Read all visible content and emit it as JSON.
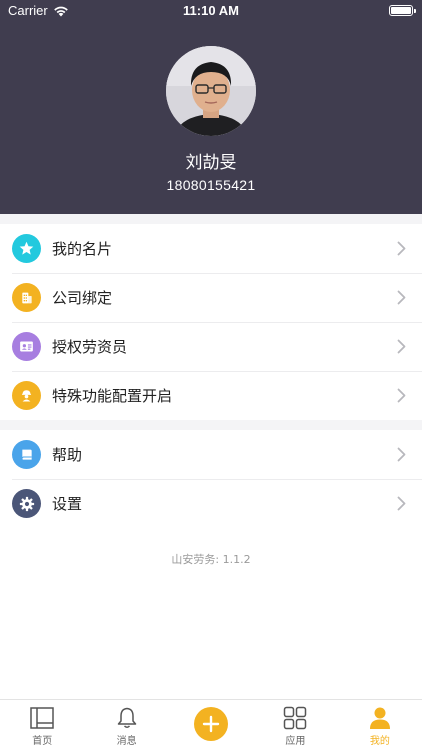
{
  "status_bar": {
    "carrier": "Carrier",
    "time": "11:10 AM"
  },
  "profile": {
    "name": "刘劼旻",
    "phone": "18080155421"
  },
  "menu_group_1": [
    {
      "label": "我的名片",
      "icon": "star-icon",
      "color": "#23c9de"
    },
    {
      "label": "公司绑定",
      "icon": "building-icon",
      "color": "#f3b221"
    },
    {
      "label": "授权劳资员",
      "icon": "id-card-icon",
      "color": "#a77ee0"
    },
    {
      "label": "特殊功能配置开启",
      "icon": "worker-icon",
      "color": "#f3b221"
    }
  ],
  "menu_group_2": [
    {
      "label": "帮助",
      "icon": "book-icon",
      "color": "#4aa4ea"
    },
    {
      "label": "设置",
      "icon": "gear-icon",
      "color": "#4b5678"
    }
  ],
  "version": "山安劳务: 1.1.2",
  "tabbar": [
    {
      "label": "首页",
      "icon": "home-icon",
      "active": false
    },
    {
      "label": "消息",
      "icon": "bell-icon",
      "active": false
    },
    {
      "label": "",
      "icon": "plus-icon",
      "active": false
    },
    {
      "label": "应用",
      "icon": "apps-grid-icon",
      "active": false
    },
    {
      "label": "我的",
      "icon": "user-icon",
      "active": true
    }
  ],
  "colors": {
    "header_bg": "#403d4f",
    "accent": "#f3b221"
  }
}
